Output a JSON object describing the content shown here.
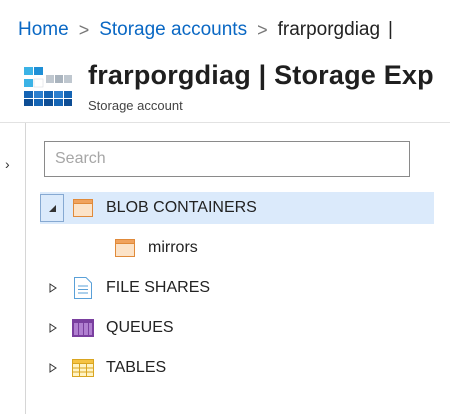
{
  "breadcrumb": {
    "items": [
      {
        "label": "Home"
      },
      {
        "label": "Storage accounts"
      }
    ],
    "separator": ">",
    "current": "frarporgdiag",
    "trailing": "|"
  },
  "header": {
    "title": "frarporgdiag | Storage Exp",
    "subtitle": "Storage account",
    "icon": "storage-account-icon"
  },
  "sidebar": {
    "expand_glyph": "›",
    "icon": "chevron-right-icon"
  },
  "search": {
    "placeholder": "Search",
    "value": ""
  },
  "tree": {
    "items": [
      {
        "label": "BLOB CONTAINERS",
        "expanded": true,
        "selected": true,
        "icon": "blob-containers-icon",
        "toggle_glyph": "◢"
      },
      {
        "label": "mirrors",
        "icon": "container-icon"
      },
      {
        "label": "FILE SHARES",
        "expanded": false,
        "icon": "file-shares-icon",
        "toggle_glyph": "▷"
      },
      {
        "label": "QUEUES",
        "expanded": false,
        "icon": "queues-icon",
        "toggle_glyph": "▷"
      },
      {
        "label": "TABLES",
        "expanded": false,
        "icon": "tables-icon",
        "toggle_glyph": "▷"
      }
    ]
  },
  "colors": {
    "link": "#0a68c4",
    "selection": "#dbeafb",
    "container_orange": "#f0a35e",
    "queue_purple": "#7a3f9f",
    "table_yellow": "#f5c242",
    "file_blue": "#5aa0d8"
  }
}
